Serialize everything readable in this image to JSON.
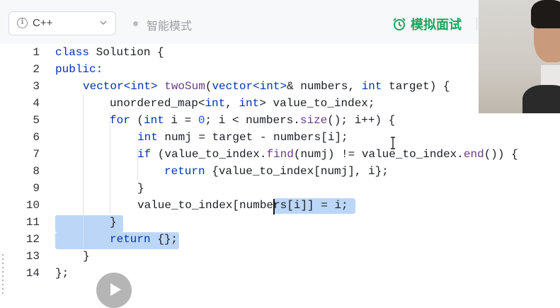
{
  "toolbar": {
    "language": "C++",
    "mode_label": "智能模式",
    "mock_interview_label": "模拟面试"
  },
  "colors": {
    "accent_green": "#1aa55c",
    "selection": "#bcd6f7",
    "keyword": "#0033b3"
  },
  "editor": {
    "line_numbers": [
      "1",
      "2",
      "3",
      "4",
      "5",
      "6",
      "7",
      "8",
      "9",
      "10",
      "11",
      "12",
      "13",
      "14"
    ]
  },
  "code_tokens": {
    "l1_class": "class",
    "l1_name": " Solution {",
    "l2": "public:",
    "l3_vector": "vector",
    "l3_int1": "<int>",
    "l3_twosum": " twoSum",
    "l3_paren": "(",
    "l3_vector2": "vector",
    "l3_int2": "<int>",
    "l3_numbers": "& numbers, ",
    "l3_int3": "int",
    "l3_target": " target) {",
    "l4_map": "unordered_map",
    "l4_lt": "<",
    "l4_int1": "int",
    "l4_comma": ", ",
    "l4_int2": "int",
    "l4_rest": "> value_to_index;",
    "l5_for": "for",
    "l5_open": " (",
    "l5_int": "int",
    "l5_ieq": " i = ",
    "l5_zero": "0",
    "l5_cond": "; i < numbers.",
    "l5_size": "size",
    "l5_rest": "(); i++) {",
    "l6_int": "int",
    "l6_rest": " numj = target - numbers[i];",
    "l7_if": "if",
    "l7_a": " (value_to_index.",
    "l7_find": "find",
    "l7_b": "(numj) != value_to_index.",
    "l7_end": "end",
    "l7_c": "()) {",
    "l8_return": "return",
    "l8_rest": " {value_to_index[numj], i};",
    "l9": "}",
    "l10_a": "value_to_index[numbe",
    "l10_b": "rs[i]] = i;",
    "l11": "}",
    "l12_return": "return",
    "l12_rest": " {};",
    "l13": "}",
    "l14": "};"
  },
  "icons": {
    "info": "info-icon",
    "chevron": "chevron-down-icon",
    "alarm": "alarm-clock-icon",
    "play": "play-icon"
  }
}
